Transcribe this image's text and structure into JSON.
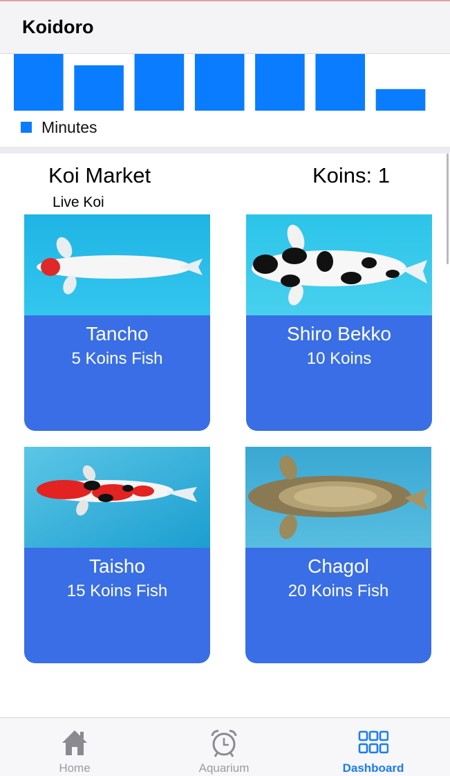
{
  "app": {
    "title": "Koidoro"
  },
  "chart_data": {
    "type": "bar",
    "values": [
      1.0,
      0.8,
      1.0,
      1.0,
      1.0,
      1.0,
      0.38
    ],
    "legend": "Minutes",
    "color": "#0a7cff"
  },
  "market": {
    "title": "Koi Market",
    "koins_label": "Koins: 1",
    "subtitle": "Live Koi"
  },
  "items": [
    {
      "name": "Tancho",
      "price": "5 Koins Fish"
    },
    {
      "name": "Shiro Bekko",
      "price": "10 Koins"
    },
    {
      "name": "Taisho",
      "price": "15 Koins Fish"
    },
    {
      "name": "Chagol",
      "price": "20 Koins Fish"
    }
  ],
  "tabs": [
    {
      "label": "Home",
      "icon": "home-icon"
    },
    {
      "label": "Aquarium",
      "icon": "alarm-clock-icon"
    },
    {
      "label": "Dashboard",
      "icon": "grid-icon",
      "active": true
    }
  ],
  "colors": {
    "accent": "#1a7af8",
    "card": "#3a6ee6",
    "water": "#29c0e8"
  }
}
